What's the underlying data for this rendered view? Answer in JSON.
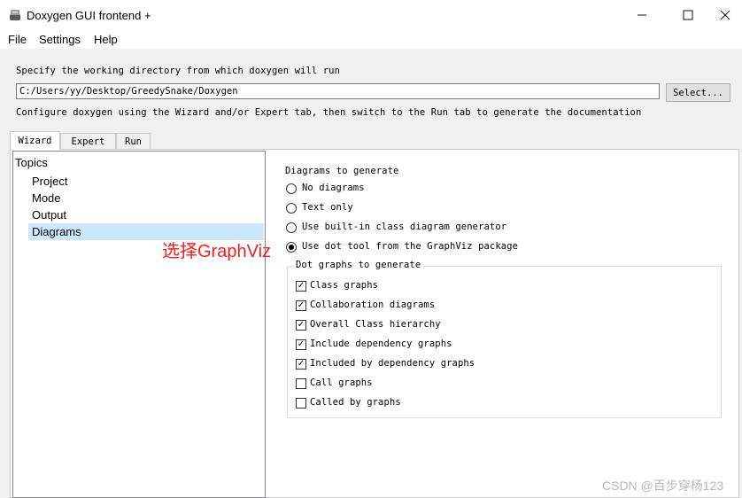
{
  "window": {
    "title": "Doxygen GUI frontend +",
    "minimize": "—",
    "maximize": "☐",
    "close": "✕"
  },
  "menu": [
    "File",
    "Settings",
    "Help"
  ],
  "workdir": {
    "label": "Specify the working directory from which doxygen will run",
    "value": "C:/Users/yy/Desktop/GreedySnake/Doxygen",
    "select_button": "Select..."
  },
  "configure_hint": "Configure doxygen using the Wizard and/or Expert tab, then switch to the Run tab to generate the documentation",
  "tabs": [
    {
      "label": "Wizard",
      "active": true
    },
    {
      "label": "Expert",
      "active": false
    },
    {
      "label": "Run",
      "active": false
    }
  ],
  "topics": {
    "header": "Topics",
    "items": [
      "Project",
      "Mode",
      "Output",
      "Diagrams"
    ],
    "selected": "Diagrams"
  },
  "annotation": "选择GraphViz",
  "diagrams": {
    "heading": "Diagrams to generate",
    "options": [
      {
        "label": "No diagrams",
        "selected": false
      },
      {
        "label": "Text only",
        "selected": false
      },
      {
        "label": "Use built-in class diagram generator",
        "selected": false
      },
      {
        "label": "Use dot tool from the GraphViz package",
        "selected": true
      }
    ],
    "dot_group_title": "Dot graphs to generate",
    "dot_graphs": [
      {
        "label": "Class graphs",
        "checked": true
      },
      {
        "label": "Collaboration diagrams",
        "checked": true
      },
      {
        "label": "Overall Class hierarchy",
        "checked": true
      },
      {
        "label": "Include dependency graphs",
        "checked": true
      },
      {
        "label": "Included by dependency graphs",
        "checked": true
      },
      {
        "label": "Call graphs",
        "checked": false
      },
      {
        "label": "Called by graphs",
        "checked": false
      }
    ]
  },
  "watermark": "CSDN @百步穿杨123",
  "colors": {
    "selection": "#cce8ff",
    "annotation": "#ff1a1a"
  }
}
